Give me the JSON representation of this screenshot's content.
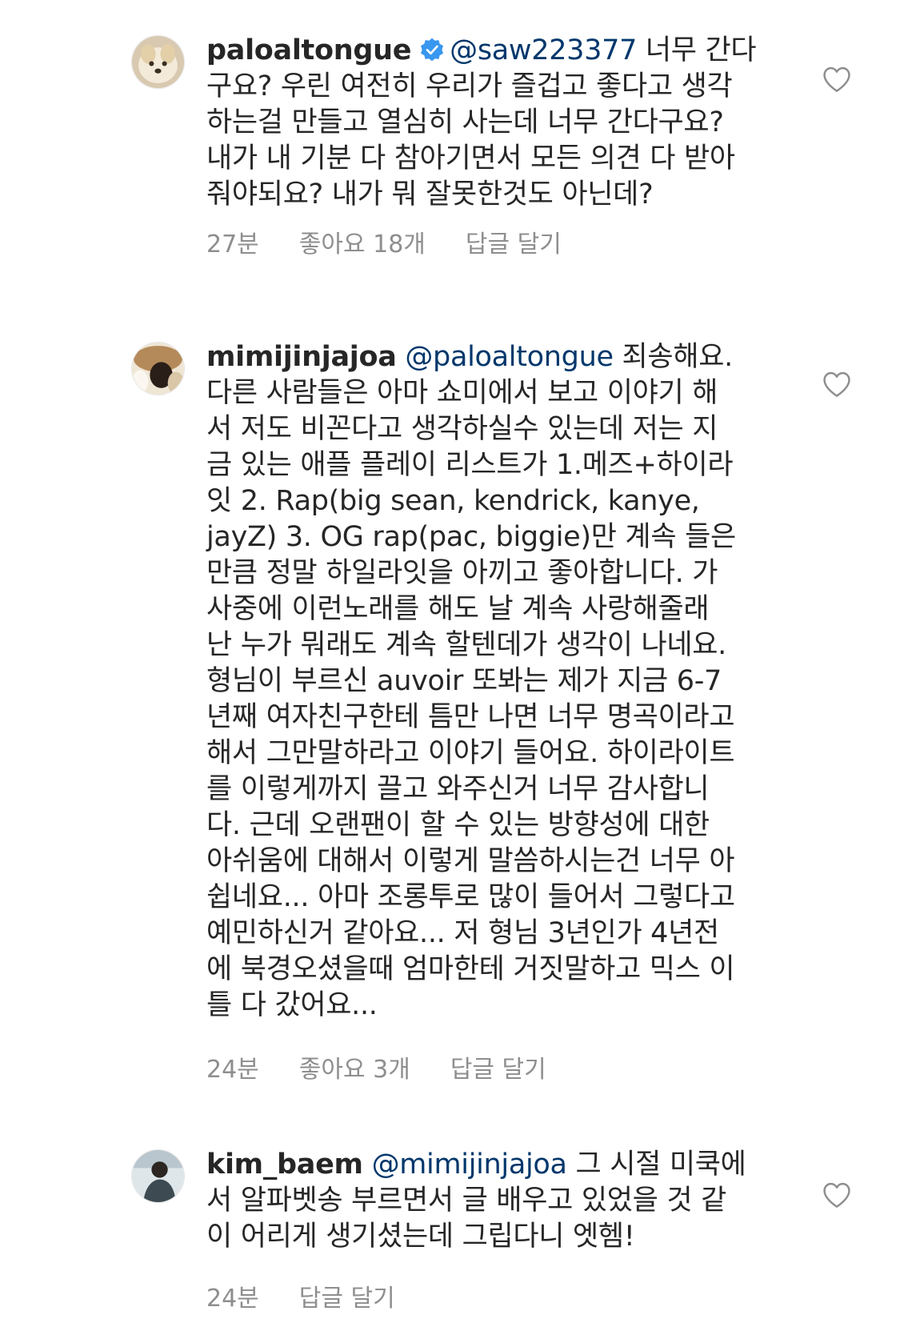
{
  "comments": [
    {
      "username": "paloaltongue",
      "verified": true,
      "mention": "@saw223377",
      "lines": [
        "너무 간다",
        "구요? 우린 여전히 우리가 즐겁고 좋다고 생각",
        "하는걸 만들고 열심히 사는데 너무 간다구요?",
        "내가 내 기분 다 참아기면서 모든 의견 다 받아",
        "줘야되요? 내가 뭐 잘못한것도 아닌데?"
      ],
      "time": "27분",
      "likes": "좋아요 18개",
      "reply": "답글 달기"
    },
    {
      "username": "mimijinjajoa",
      "verified": false,
      "mention": "@paloaltongue",
      "lines": [
        "죄송해요.",
        "다른 사람들은 아마 쇼미에서 보고 이야기 해",
        "서 저도 비꼰다고 생각하실수 있는데 저는 지",
        "금 있는 애플 플레이 리스트가 1.메즈+하이라",
        "잇 2. Rap(big sean, kendrick, kanye,",
        "jayZ) 3. OG rap(pac, biggie)만 계속 들은",
        "만큼 정말 하일라잇을 아끼고 좋아합니다. 가",
        "사중에 이런노래를 해도 날 계속 사랑해줄래",
        "난 누가 뭐래도 계속 할텐데가 생각이 나네요.",
        "형님이 부르신 auvoir 또봐는 제가 지금 6-7",
        "년째 여자친구한테 틈만 나면 너무 명곡이라고",
        "해서 그만말하라고 이야기 들어요. 하이라이트",
        "를 이렇게까지 끌고 와주신거 너무 감사합니",
        "다. 근데 오랜팬이 할 수 있는 방향성에 대한",
        "아쉬움에 대해서 이렇게 말씀하시는건 너무 아",
        "쉽네요... 아마 조롱투로 많이 들어서 그렇다고",
        "예민하신거 같아요... 저 형님 3년인가 4년전",
        "에 북경오셨을때 엄마한테 거짓말하고 믹스 이",
        "틀 다 갔어요..."
      ],
      "time": "24분",
      "likes": "좋아요 3개",
      "reply": "답글 달기"
    },
    {
      "username": "kim_baem",
      "verified": false,
      "mention": "@mimijinjajoa",
      "lines": [
        "그 시절 미쿡에",
        "서 알파벳송 부르면서 글 배우고 있었을 것 같",
        "이 어리게 생기셨는데 그립다니 엣헴!"
      ],
      "time": "24분",
      "likes": "",
      "reply": "답글 달기"
    }
  ],
  "colors": {
    "text": "#262626",
    "mention": "#00376b",
    "meta": "#8e8e8e",
    "verified": "#3897f0"
  },
  "icons": {
    "like": "heart-outline-icon",
    "verified": "verified-badge-icon"
  }
}
